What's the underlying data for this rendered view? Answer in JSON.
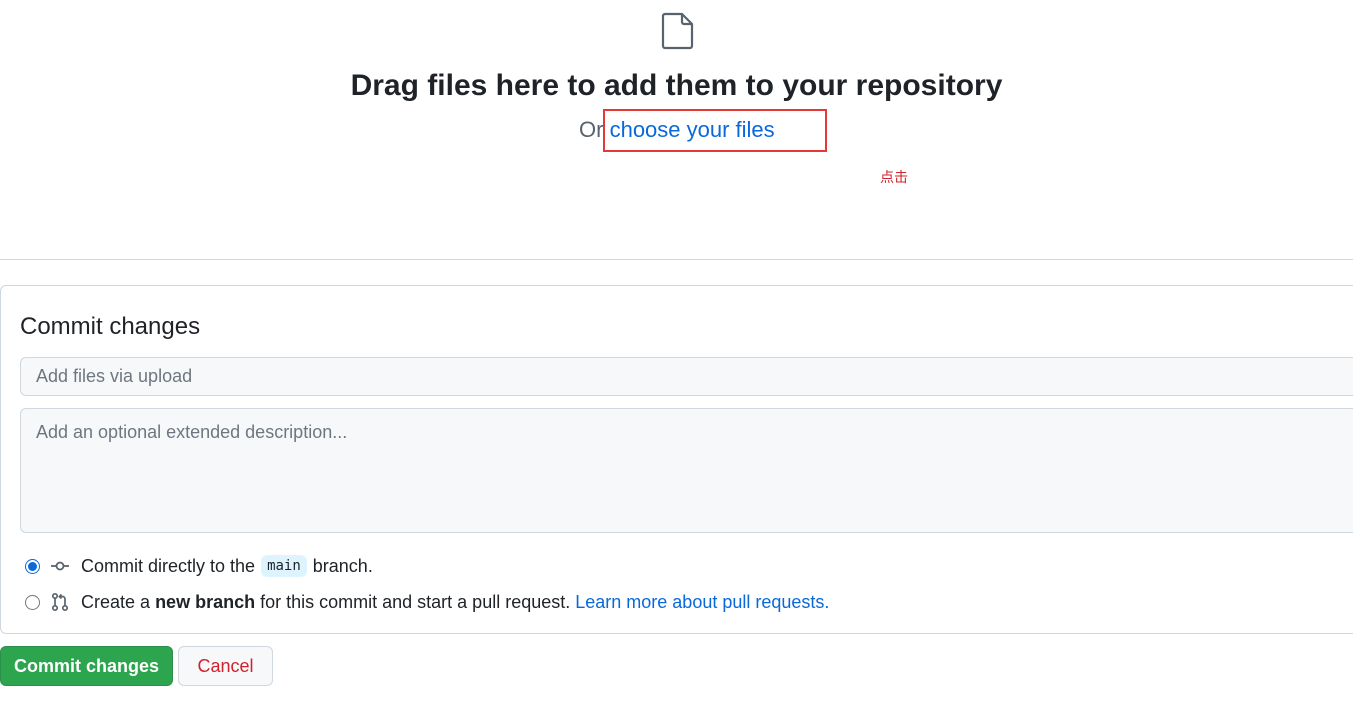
{
  "upload": {
    "title": "Drag files here to add them to your repository",
    "or_text": "Or",
    "choose_link": "choose your files",
    "annotation": "点击"
  },
  "commit": {
    "heading": "Commit changes",
    "summary_placeholder": "Add files via upload",
    "description_placeholder": "Add an optional extended description...",
    "option_direct": {
      "prefix": "Commit directly to the",
      "branch": "main",
      "suffix": "branch.",
      "selected": true
    },
    "option_new_branch": {
      "prefix": "Create a",
      "bold": "new branch",
      "suffix": "for this commit and start a pull request.",
      "link": "Learn more about pull requests.",
      "selected": false
    }
  },
  "buttons": {
    "commit": "Commit changes",
    "cancel": "Cancel"
  },
  "colors": {
    "link": "#0969da",
    "primary_button": "#2da44e",
    "danger_text": "#cf222e",
    "annotation_box": "#e5383b"
  },
  "icons": [
    "file-icon",
    "git-commit-icon",
    "git-pull-request-icon"
  ]
}
